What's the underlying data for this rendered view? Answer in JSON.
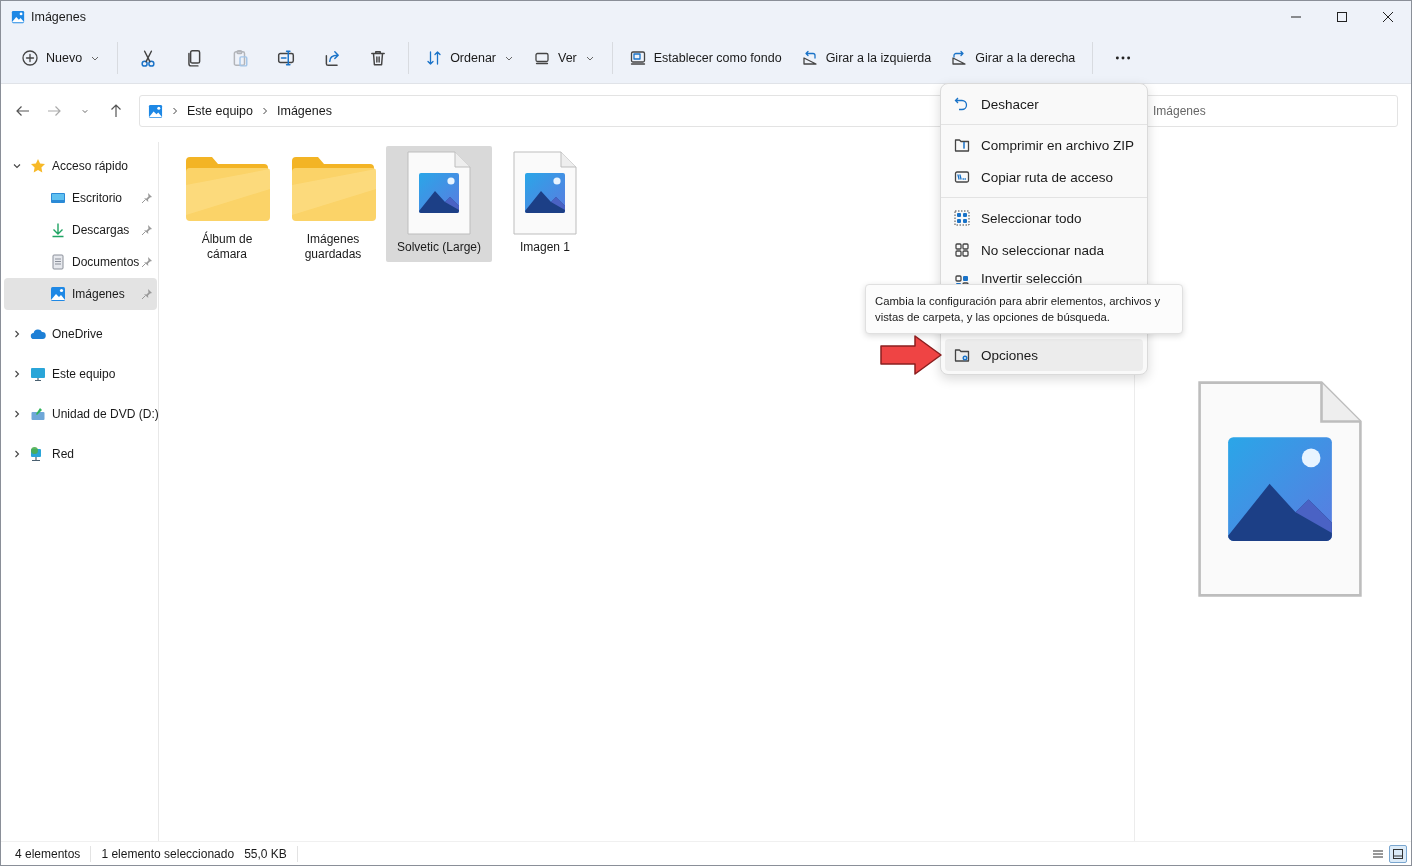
{
  "window": {
    "title": "Imágenes"
  },
  "toolbar": {
    "new_button": {
      "label": "Nuevo"
    },
    "icon_buttons": [
      {
        "disabled": false
      },
      {
        "disabled": false
      },
      {
        "disabled": true
      },
      {
        "disabled": false
      },
      {
        "disabled": false
      },
      {
        "disabled": false
      }
    ],
    "commands": [
      {
        "label": "Ordenar",
        "dropdown": true
      },
      {
        "label": "Ver",
        "dropdown": true
      },
      {
        "label": "Establecer como fondo",
        "dropdown": false
      },
      {
        "label": "Girar a la izquierda",
        "dropdown": false
      },
      {
        "label": "Girar a la derecha",
        "dropdown": false
      }
    ]
  },
  "address_bar": {
    "breadcrumb": [
      "Este equipo",
      "Imágenes"
    ]
  },
  "search": {
    "placeholder": "Imágenes"
  },
  "sidebar": {
    "items": [
      {
        "label": "Acceso rápido",
        "kind": "star",
        "expanded": true,
        "selected": false,
        "children": [
          {
            "label": "Escritorio",
            "kind": "desktop",
            "pinned": true,
            "selected": false
          },
          {
            "label": "Descargas",
            "kind": "download",
            "pinned": true,
            "selected": false
          },
          {
            "label": "Documentos",
            "kind": "document",
            "pinned": true,
            "selected": false
          },
          {
            "label": "Imágenes",
            "kind": "pictures",
            "pinned": true,
            "selected": true
          }
        ]
      },
      {
        "label": "OneDrive",
        "kind": "cloud",
        "expanded": false,
        "selected": false
      },
      {
        "label": "Este equipo",
        "kind": "monitor",
        "expanded": false,
        "selected": false
      },
      {
        "label": "Unidad de DVD (D:)",
        "kind": "disc",
        "expanded": false,
        "selected": false
      },
      {
        "label": "Red",
        "kind": "network",
        "expanded": false,
        "selected": false
      }
    ]
  },
  "files": [
    {
      "name": "Álbum de cámara",
      "kind": "folder",
      "selected": false
    },
    {
      "name": "Imágenes guardadas",
      "kind": "folder",
      "selected": false
    },
    {
      "name": "Solvetic (Large)",
      "kind": "image",
      "selected": true
    },
    {
      "name": "Imagen 1",
      "kind": "image",
      "selected": false
    }
  ],
  "context_menu": {
    "groups": [
      [
        {
          "label": "Deshacer",
          "kind": "undo",
          "highlighted": false
        }
      ],
      [
        {
          "label": "Comprimir en archivo ZIP",
          "kind": "zip",
          "highlighted": false
        },
        {
          "label": "Copiar ruta de acceso",
          "kind": "path",
          "highlighted": false
        }
      ],
      [
        {
          "label": "Seleccionar todo",
          "kind": "select_all",
          "highlighted": false
        },
        {
          "label": "No seleccionar nada",
          "kind": "select_none",
          "highlighted": false
        },
        {
          "label": "Invertir selección",
          "kind": "invert",
          "highlighted": false
        }
      ],
      [
        {
          "label": "Opciones",
          "kind": "options",
          "highlighted": true
        }
      ]
    ]
  },
  "tooltip": {
    "text": "Cambia la configuración para abrir elementos, archivos y vistas de carpeta, y las opciones de búsqueda."
  },
  "status_bar": {
    "item_count": "4 elementos",
    "selection": "1 elemento seleccionado",
    "size": "55,0 KB",
    "views": [
      {
        "kind": "details",
        "selected": false
      },
      {
        "kind": "large_icons",
        "selected": true
      }
    ]
  }
}
